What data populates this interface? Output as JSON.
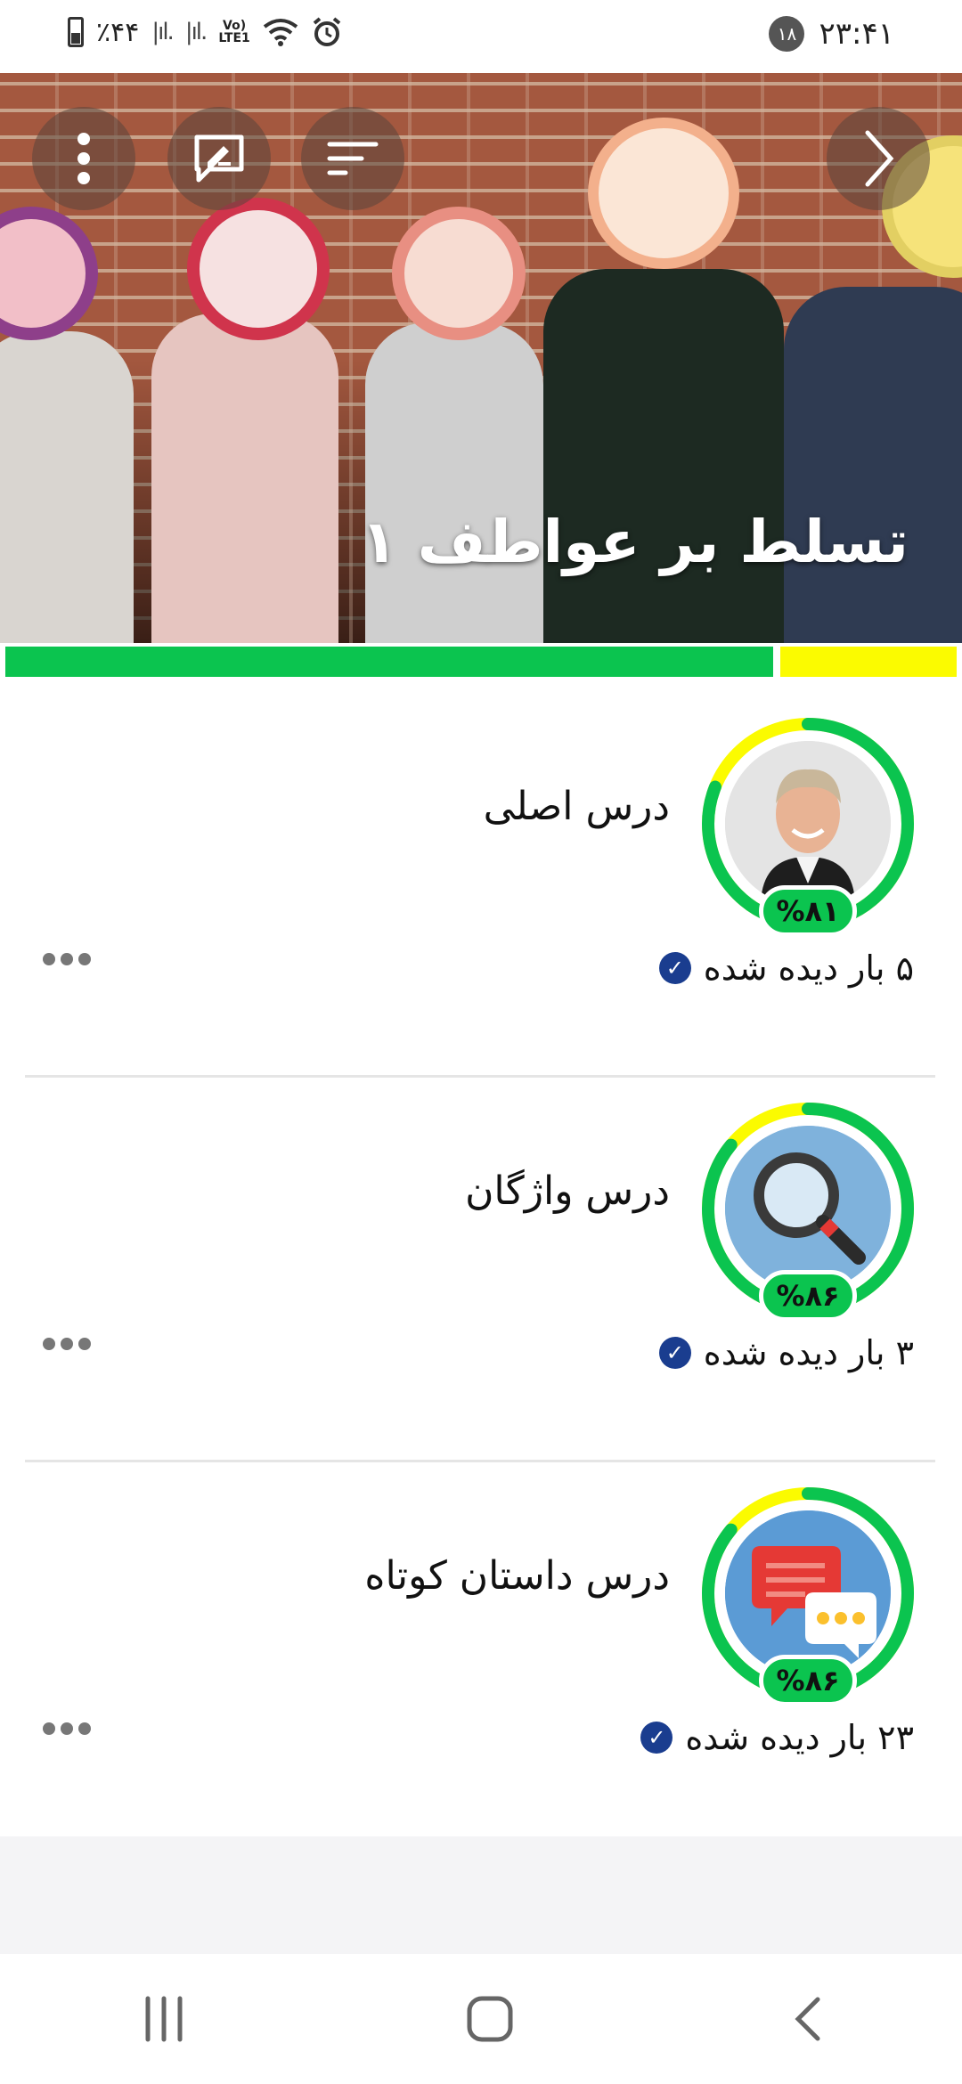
{
  "status_bar": {
    "battery_text": "٪۴۴",
    "lte_top": "Vo)",
    "lte_bottom": "LTE1",
    "notification_count": "۱۸",
    "time": "۲۳:۴۱"
  },
  "hero": {
    "title": "تسلط بر عواطف ۱",
    "icons": [
      "more-vert-icon",
      "feedback-icon",
      "sort-icon",
      "chevron-right-icon"
    ]
  },
  "progress": {
    "green_fraction": 0.81,
    "colors": {
      "complete": "#0bc44f",
      "remaining": "#fbfb00"
    }
  },
  "lessons": [
    {
      "title": "درس اصلی",
      "percent_label": "%۸۱",
      "percent": 81,
      "seen": "۵ بار دیده شده",
      "thumb": "man-portrait"
    },
    {
      "title": "درس واژگان",
      "percent_label": "%۸۶",
      "percent": 86,
      "seen": "۳ بار دیده شده",
      "thumb": "magnifier-icon"
    },
    {
      "title": "درس داستان کوتاه",
      "percent_label": "%۸۶",
      "percent": 86,
      "seen": "۲۳ بار دیده شده",
      "thumb": "chat-bubbles-icon"
    }
  ],
  "nav": {
    "icons": [
      "recents-icon",
      "home-icon",
      "back-icon"
    ]
  }
}
